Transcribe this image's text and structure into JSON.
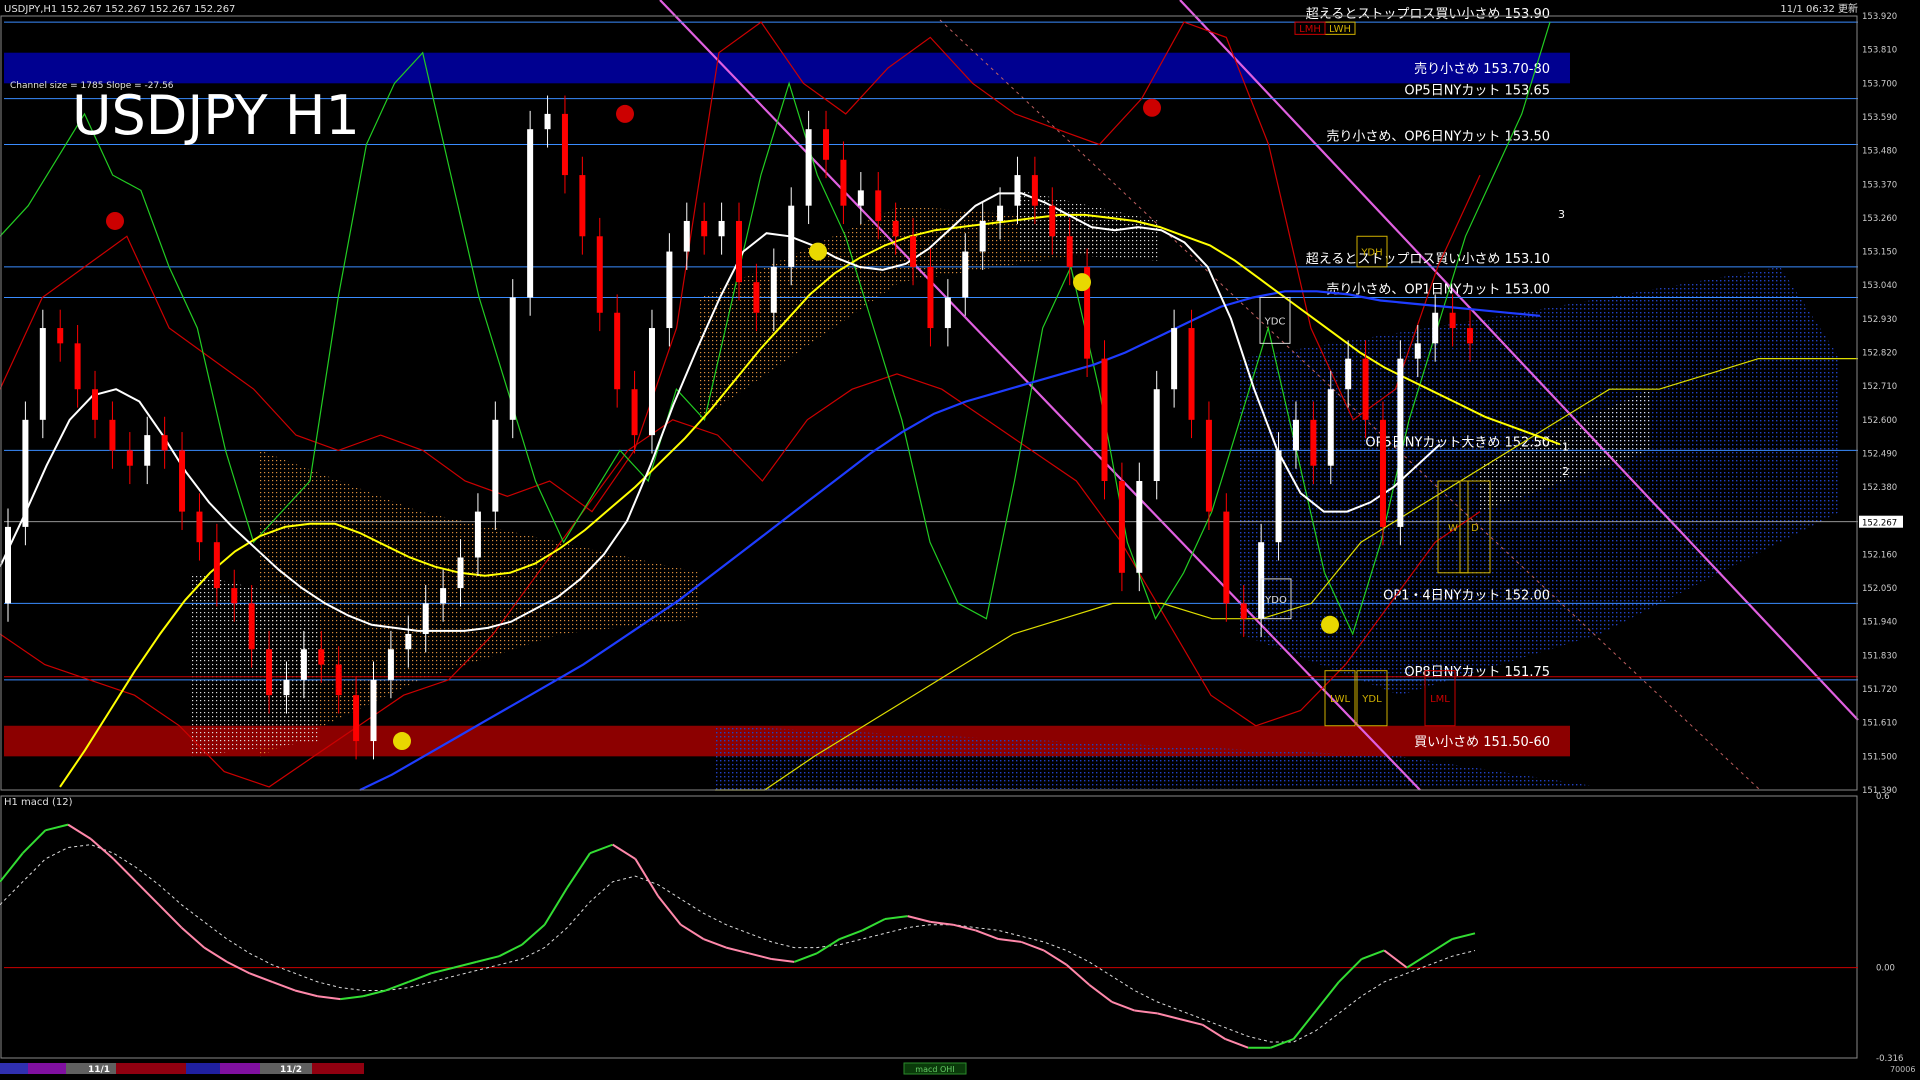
{
  "header": {
    "symbol_info": "USDJPY,H1  152.267 152.267 152.267 152.267",
    "server_time": "11/1 06:32 更新"
  },
  "chart_title": "USDJPY H1",
  "channel_info": "Channel size = 1785 Slope = -27.56",
  "colors": {
    "background": "#000000",
    "bull_candle": "#ffffff",
    "bear_candle": "#ff0000",
    "ma_white": "#ffffff",
    "ma_yellow": "#ffff00",
    "ma_blue": "#1e3cff",
    "bollinger": "#cc0000",
    "rsi_green": "#22cc22",
    "kumo_orange": "#d88c3c",
    "kumo_blue": "#2040c0",
    "channel_magenta": "#e060e0",
    "level_line": "#3a8cff",
    "sell_zone": "#000090",
    "buy_zone": "#8c0000"
  },
  "chart_data": {
    "type": "line",
    "price_axis": {
      "ylim": [
        151.39,
        153.92
      ],
      "tick_labels": [
        "153.920",
        "153.810",
        "153.700",
        "153.590",
        "153.480",
        "153.370",
        "153.260",
        "153.150",
        "153.040",
        "152.930",
        "152.820",
        "152.710",
        "152.600",
        "152.490",
        "152.380",
        "152.270",
        "152.160",
        "152.050",
        "151.940",
        "151.830",
        "151.720",
        "151.610",
        "151.500",
        "151.390"
      ],
      "current_price": "152.267"
    },
    "zones": [
      {
        "label": "売り小さめ 153.70-80",
        "from": 153.7,
        "to": 153.8,
        "color": "#000090"
      },
      {
        "label": "買い小さめ 151.50-60",
        "from": 151.5,
        "to": 151.6,
        "color": "#8c0000"
      }
    ],
    "levels": [
      {
        "price": 153.9,
        "label": "超えるとストップロス買い小さめ 153.90"
      },
      {
        "price": 153.65,
        "label": "OP5日NYカット 153.65"
      },
      {
        "price": 153.5,
        "label": "売り小さめ、OP6日NYカット 153.50"
      },
      {
        "price": 153.1,
        "label": "超えるとストップロス買い小さめ 153.10"
      },
      {
        "price": 153.0,
        "label": "売り小さめ、OP1日NYカット 153.00"
      },
      {
        "price": 152.5,
        "label": "OP5日NYカット大きめ 152.50"
      },
      {
        "price": 152.0,
        "label": "OP1・4日NYカット 152.00"
      },
      {
        "price": 151.75,
        "label": "OP8日NYカット 151.75"
      }
    ],
    "markers": [
      "YDC",
      "YDO",
      "YDH",
      "YDL",
      "LWL",
      "LWH",
      "LMH",
      "LML",
      "W",
      "D",
      "1",
      "2",
      "3"
    ],
    "ma_white": [
      152.12,
      152.28,
      152.45,
      152.6,
      152.68,
      152.7,
      152.66,
      152.55,
      152.43,
      152.33,
      152.25,
      152.18,
      152.11,
      152.05,
      152.0,
      151.96,
      151.93,
      151.92,
      151.91,
      151.91,
      151.91,
      151.92,
      151.94,
      151.98,
      152.02,
      152.08,
      152.16,
      152.27,
      152.45,
      152.65,
      152.83,
      153.0,
      153.15,
      153.21,
      153.2,
      153.17,
      153.13,
      153.1,
      153.09,
      153.11,
      153.16,
      153.23,
      153.3,
      153.34,
      153.34,
      153.31,
      153.27,
      153.23,
      153.22,
      153.23,
      153.22,
      153.18,
      153.1,
      152.93,
      152.7,
      152.5,
      152.36,
      152.3,
      152.3,
      152.33,
      152.38,
      152.45,
      152.52
    ],
    "ma_yellow": [
      151.4,
      151.52,
      151.65,
      151.78,
      151.9,
      152.01,
      152.1,
      152.17,
      152.22,
      152.25,
      152.26,
      152.26,
      152.23,
      152.19,
      152.15,
      152.12,
      152.1,
      152.09,
      152.1,
      152.13,
      152.18,
      152.24,
      152.31,
      152.38,
      152.46,
      152.54,
      152.63,
      152.73,
      152.83,
      152.92,
      153.01,
      153.08,
      153.13,
      153.17,
      153.2,
      153.22,
      153.23,
      153.24,
      153.25,
      153.26,
      153.27,
      153.27,
      153.26,
      153.25,
      153.23,
      153.2,
      153.17,
      153.12,
      153.06,
      153.0,
      152.94,
      152.88,
      152.82,
      152.77,
      152.73,
      152.69,
      152.65,
      152.61,
      152.58,
      152.55,
      152.52
    ],
    "ma_blue": [
      151.39,
      151.44,
      151.5,
      151.56,
      151.62,
      151.68,
      151.74,
      151.8,
      151.87,
      151.94,
      152.01,
      152.09,
      152.17,
      152.25,
      152.33,
      152.41,
      152.49,
      152.56,
      152.62,
      152.66,
      152.69,
      152.72,
      152.75,
      152.78,
      152.82,
      152.87,
      152.92,
      152.97,
      153.0,
      153.02,
      153.02,
      153.01,
      152.99,
      152.98,
      152.97,
      152.96,
      152.95,
      152.94
    ],
    "candles": [
      [
        152.0,
        152.25
      ],
      [
        152.25,
        152.6
      ],
      [
        152.6,
        152.9
      ],
      [
        152.9,
        152.85
      ],
      [
        152.85,
        152.7
      ],
      [
        152.7,
        152.6
      ],
      [
        152.6,
        152.5
      ],
      [
        152.5,
        152.45
      ],
      [
        152.45,
        152.55
      ],
      [
        152.55,
        152.5
      ],
      [
        152.5,
        152.3
      ],
      [
        152.3,
        152.2
      ],
      [
        152.2,
        152.05
      ],
      [
        152.05,
        152.0
      ],
      [
        152.0,
        151.85
      ],
      [
        151.85,
        151.7
      ],
      [
        151.7,
        151.75
      ],
      [
        151.75,
        151.85
      ],
      [
        151.85,
        151.8
      ],
      [
        151.8,
        151.7
      ],
      [
        151.7,
        151.55
      ],
      [
        151.55,
        151.75
      ],
      [
        151.75,
        151.85
      ],
      [
        151.85,
        151.9
      ],
      [
        151.9,
        152.0
      ],
      [
        152.0,
        152.05
      ],
      [
        152.05,
        152.15
      ],
      [
        152.15,
        152.3
      ],
      [
        152.3,
        152.6
      ],
      [
        152.6,
        153.0
      ],
      [
        153.0,
        153.55
      ],
      [
        153.55,
        153.6
      ],
      [
        153.6,
        153.4
      ],
      [
        153.4,
        153.2
      ],
      [
        153.2,
        152.95
      ],
      [
        152.95,
        152.7
      ],
      [
        152.7,
        152.55
      ],
      [
        152.55,
        152.9
      ],
      [
        152.9,
        153.15
      ],
      [
        153.15,
        153.25
      ],
      [
        153.25,
        153.2
      ],
      [
        153.2,
        153.25
      ],
      [
        153.25,
        153.05
      ],
      [
        153.05,
        152.95
      ],
      [
        152.95,
        153.1
      ],
      [
        153.1,
        153.3
      ],
      [
        153.3,
        153.55
      ],
      [
        153.55,
        153.45
      ],
      [
        153.45,
        153.3
      ],
      [
        153.3,
        153.35
      ],
      [
        153.35,
        153.25
      ],
      [
        153.25,
        153.2
      ],
      [
        153.2,
        153.1
      ],
      [
        153.1,
        152.9
      ],
      [
        152.9,
        153.0
      ],
      [
        153.0,
        153.15
      ],
      [
        153.15,
        153.25
      ],
      [
        153.25,
        153.3
      ],
      [
        153.3,
        153.4
      ],
      [
        153.4,
        153.3
      ],
      [
        153.3,
        153.2
      ],
      [
        153.2,
        153.1
      ],
      [
        153.1,
        152.8
      ],
      [
        152.8,
        152.4
      ],
      [
        152.4,
        152.1
      ],
      [
        152.1,
        152.4
      ],
      [
        152.4,
        152.7
      ],
      [
        152.7,
        152.9
      ],
      [
        152.9,
        152.6
      ],
      [
        152.6,
        152.3
      ],
      [
        152.3,
        152.0
      ],
      [
        152.0,
        151.95
      ],
      [
        151.95,
        152.2
      ],
      [
        152.2,
        152.5
      ],
      [
        152.5,
        152.6
      ],
      [
        152.6,
        152.45
      ],
      [
        152.45,
        152.7
      ],
      [
        152.7,
        152.8
      ],
      [
        152.8,
        152.6
      ],
      [
        152.6,
        152.25
      ],
      [
        152.25,
        152.8
      ],
      [
        152.8,
        152.85
      ],
      [
        152.85,
        152.95
      ],
      [
        152.95,
        152.9
      ],
      [
        152.9,
        152.85
      ]
    ],
    "macd": {
      "title": "H1 macd (12)",
      "ylim": [
        -0.316,
        0.6
      ],
      "tick_labels": [
        "0.6",
        "0.00",
        "-0.316"
      ],
      "main": [
        0.3,
        0.4,
        0.48,
        0.5,
        0.45,
        0.38,
        0.3,
        0.22,
        0.14,
        0.07,
        0.02,
        -0.02,
        -0.05,
        -0.08,
        -0.1,
        -0.11,
        -0.1,
        -0.08,
        -0.05,
        -0.02,
        0.0,
        0.02,
        0.04,
        0.08,
        0.15,
        0.28,
        0.4,
        0.43,
        0.38,
        0.25,
        0.15,
        0.1,
        0.07,
        0.05,
        0.03,
        0.02,
        0.05,
        0.1,
        0.13,
        0.17,
        0.18,
        0.16,
        0.15,
        0.13,
        0.1,
        0.09,
        0.06,
        0.01,
        -0.06,
        -0.12,
        -0.15,
        -0.16,
        -0.18,
        -0.2,
        -0.25,
        -0.28,
        -0.28,
        -0.25,
        -0.15,
        -0.05,
        0.03,
        0.06,
        0.0,
        0.05,
        0.1,
        0.12
      ],
      "signal": [
        0.22,
        0.3,
        0.38,
        0.42,
        0.43,
        0.4,
        0.35,
        0.29,
        0.22,
        0.16,
        0.1,
        0.05,
        0.01,
        -0.02,
        -0.05,
        -0.07,
        -0.08,
        -0.08,
        -0.07,
        -0.05,
        -0.03,
        -0.01,
        0.01,
        0.03,
        0.07,
        0.14,
        0.23,
        0.3,
        0.32,
        0.29,
        0.24,
        0.19,
        0.15,
        0.12,
        0.09,
        0.07,
        0.07,
        0.08,
        0.1,
        0.12,
        0.14,
        0.15,
        0.15,
        0.14,
        0.13,
        0.11,
        0.09,
        0.06,
        0.02,
        -0.03,
        -0.08,
        -0.12,
        -0.15,
        -0.18,
        -0.21,
        -0.24,
        -0.26,
        -0.26,
        -0.22,
        -0.16,
        -0.1,
        -0.05,
        -0.02,
        0.01,
        0.04,
        0.06
      ]
    }
  },
  "bottom_bar": {
    "dates": [
      "11/1",
      "11/2"
    ],
    "indicator_label": "macd OHI",
    "corner": "70006"
  }
}
